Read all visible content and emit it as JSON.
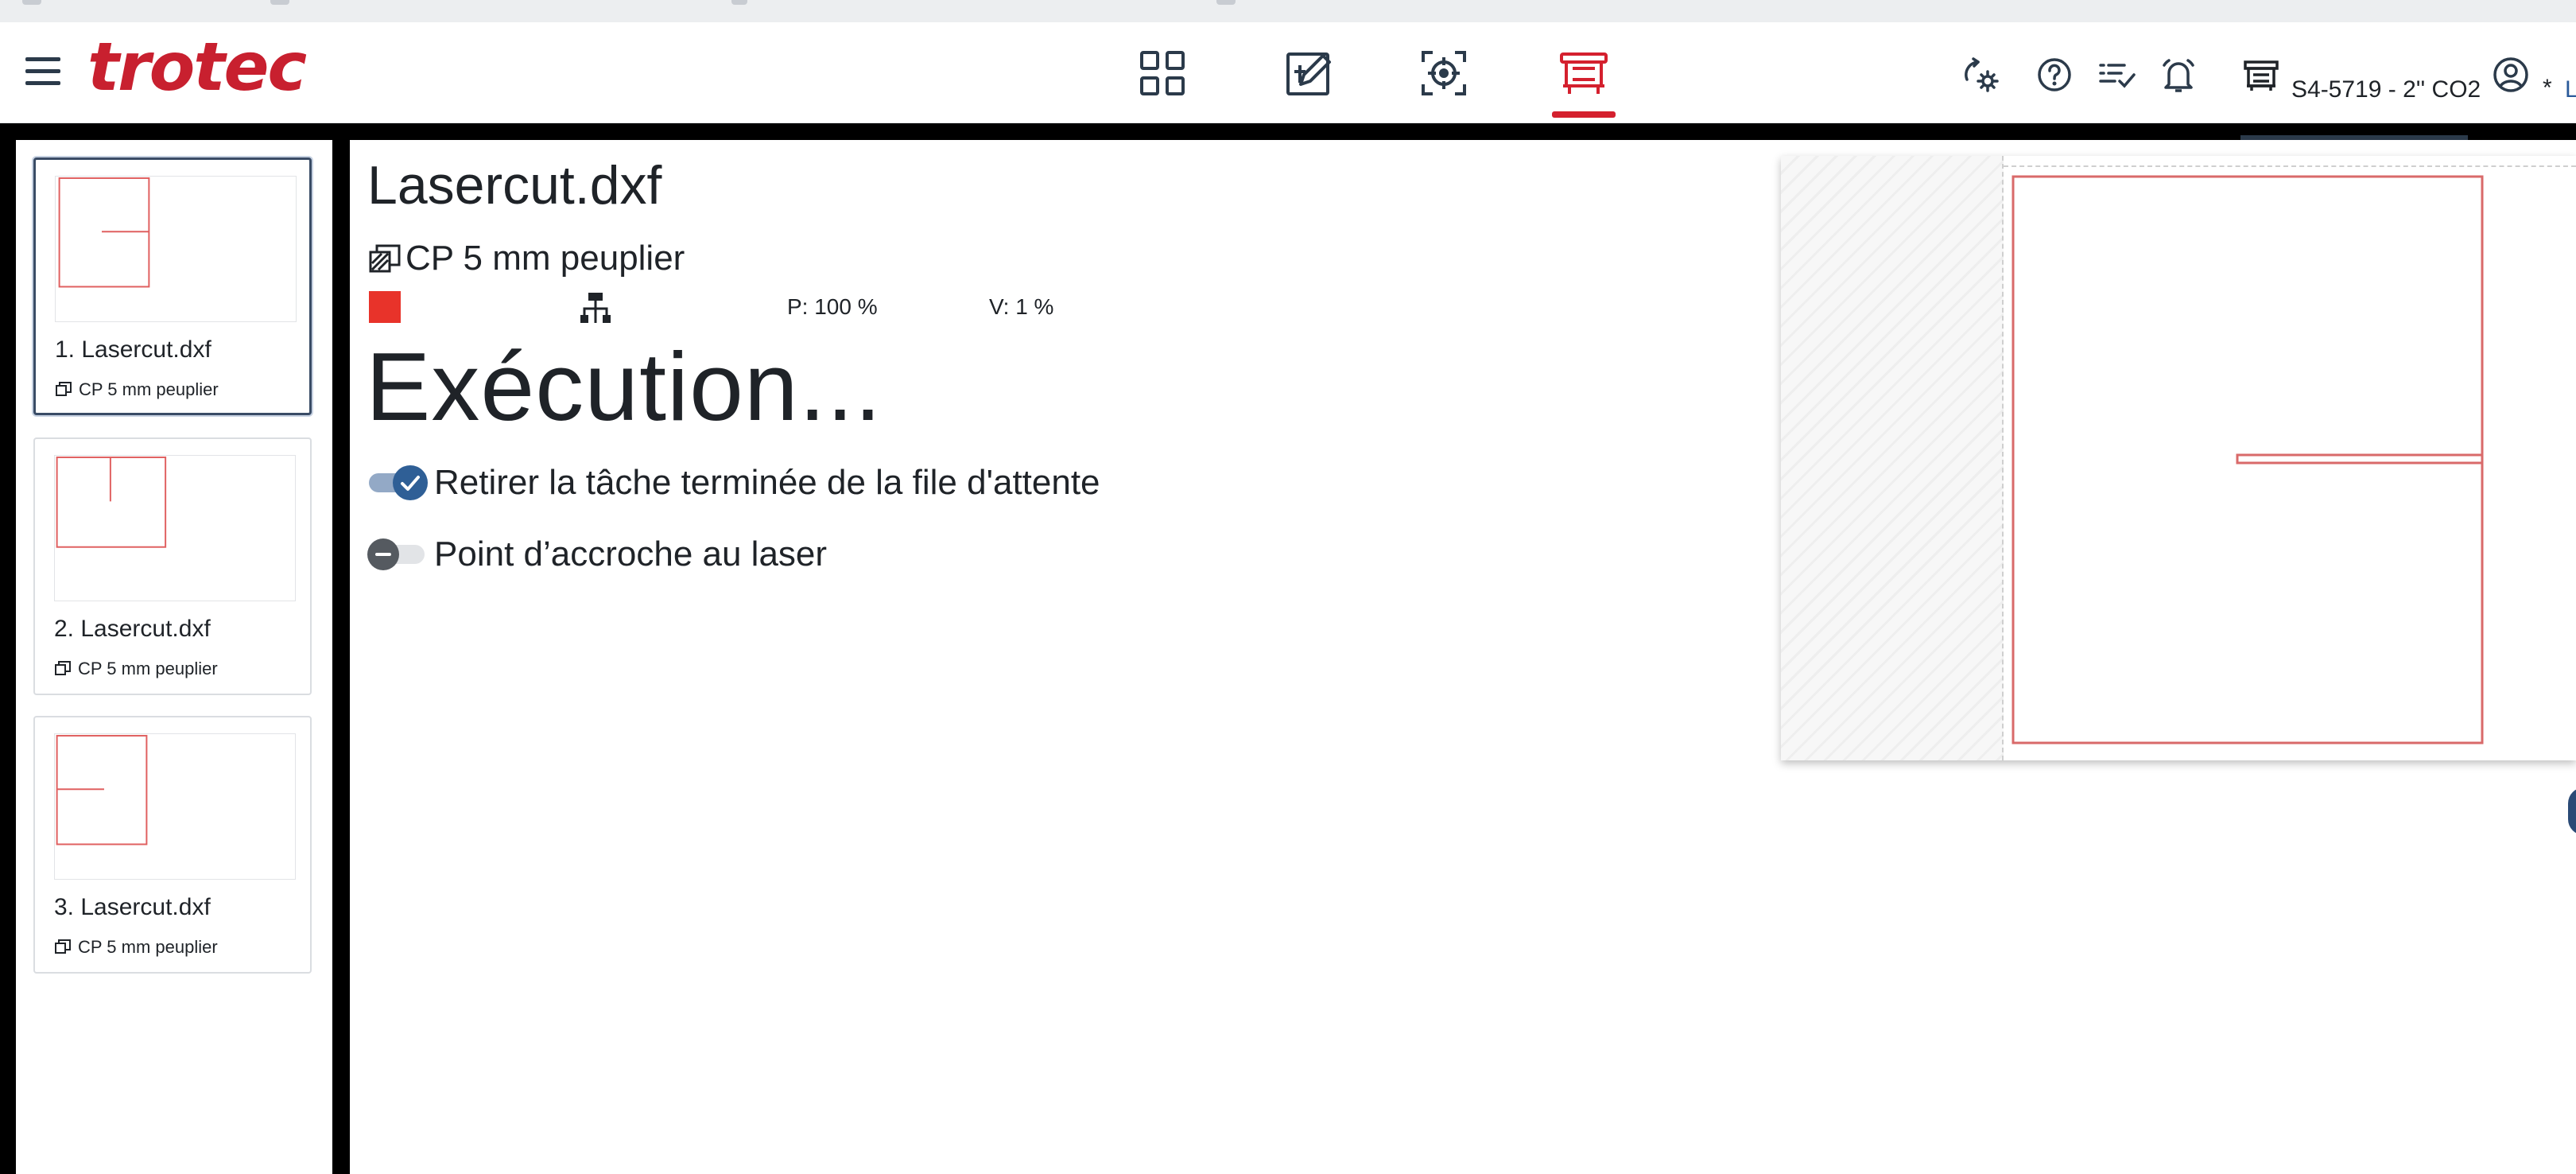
{
  "app": {
    "logo": "trotec"
  },
  "nav": {
    "tabs": [
      {
        "name": "dashboard-tab",
        "icon": "grid-icon"
      },
      {
        "name": "design-tab",
        "icon": "edit-pen-icon"
      },
      {
        "name": "position-tab",
        "icon": "crosshair-target-icon"
      },
      {
        "name": "job-queue-tab",
        "icon": "laser-machine-icon",
        "active": true
      }
    ],
    "active_color": "#d4202e"
  },
  "header": {
    "icons": [
      "sync-settings-icon",
      "help-icon",
      "task-list-icon",
      "bell-icon",
      "machine-icon",
      "user-icon"
    ],
    "machine_name": "S4-5719 - 2'' CO2",
    "machine_progress": 1.0,
    "user_indicator": "*",
    "user_name_partial": "L"
  },
  "queue": {
    "jobs": [
      {
        "label": "1. Lasercut.dxf",
        "material": "CP 5 mm peuplier",
        "selected": true
      },
      {
        "label": "2. Lasercut.dxf",
        "material": "CP 5 mm peuplier",
        "selected": false
      },
      {
        "label": "3. Lasercut.dxf",
        "material": "CP 5 mm peuplier",
        "selected": false
      }
    ]
  },
  "job": {
    "title": "Lasercut.dxf",
    "material": "CP 5 mm peuplier",
    "layer_color": "#e8332a",
    "power": "P: 100 %",
    "speed": "V: 1 %",
    "status": "Exécution..."
  },
  "options": {
    "remove_finished": {
      "label": "Retirer la tâche terminée de la file d'attente",
      "checked": true
    },
    "laser_pointer": {
      "label": "Point d’accroche au laser",
      "checked": false
    }
  },
  "colors": {
    "brand": "#c8202f",
    "cut_line": "#e06060",
    "toggle_on": "#2f5f96",
    "toggle_off": "#555a60"
  }
}
